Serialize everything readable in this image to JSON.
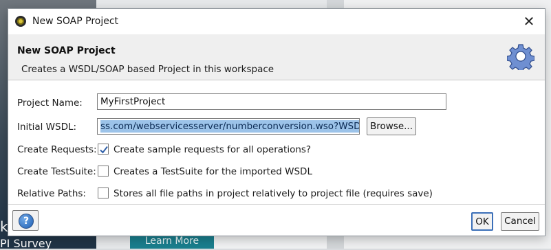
{
  "background": {
    "left_text_1": "ke",
    "left_text_2": "PI Survey",
    "learn_more": "Learn More"
  },
  "dialog": {
    "title": "New SOAP Project",
    "header": {
      "title": "New SOAP Project",
      "description": "Creates a WSDL/SOAP based Project in this workspace"
    },
    "fields": {
      "project_name_label": "Project Name:",
      "project_name_value": "MyFirstProject",
      "initial_wsdl_label": "Initial WSDL:",
      "initial_wsdl_value": "ss.com/webservicesserver/numberconversion.wso?WSDL",
      "browse_label": "Browse...",
      "create_requests_label": "Create Requests:",
      "create_requests_text": "Create sample requests for all operations?",
      "create_requests_checked": true,
      "create_testsuite_label": "Create TestSuite:",
      "create_testsuite_text": "Creates a TestSuite for the imported WSDL",
      "create_testsuite_checked": false,
      "relative_paths_label": "Relative Paths:",
      "relative_paths_text": "Stores all file paths in project relatively to project file (requires save)",
      "relative_paths_checked": false
    },
    "buttons": {
      "ok": "OK",
      "cancel": "Cancel"
    },
    "icons": {
      "app": "soapui-icon",
      "gear": "gear-icon",
      "help": "help-icon",
      "close": "close-icon"
    },
    "colors": {
      "selection": "#9cc3e9",
      "header_bg": "#efefef"
    }
  }
}
